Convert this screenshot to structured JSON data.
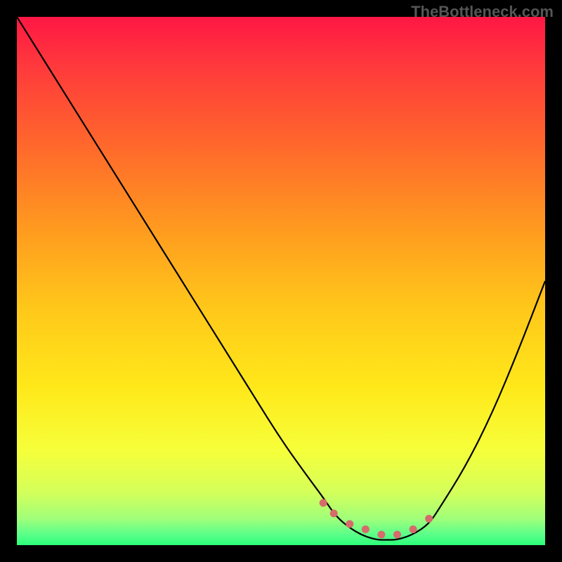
{
  "watermark": "TheBottleneck.com",
  "chart_data": {
    "type": "line",
    "title": "",
    "xlabel": "",
    "ylabel": "",
    "xlim": [
      0,
      100
    ],
    "ylim": [
      0,
      100
    ],
    "series": [
      {
        "name": "bottleneck-curve",
        "x": [
          0,
          5,
          10,
          15,
          20,
          25,
          30,
          35,
          40,
          45,
          50,
          55,
          58,
          60,
          62,
          65,
          68,
          70,
          72,
          75,
          78,
          80,
          85,
          90,
          95,
          100
        ],
        "y": [
          100,
          92,
          84,
          76,
          68,
          60,
          52,
          44,
          36,
          28,
          20,
          13,
          9,
          6,
          4,
          2,
          1,
          1,
          1,
          2,
          4,
          7,
          15,
          25,
          37,
          50
        ]
      }
    ],
    "markers": {
      "name": "optimal-range-dots",
      "x": [
        58,
        60,
        63,
        66,
        69,
        72,
        75,
        78
      ],
      "y": [
        8,
        6,
        4,
        3,
        2,
        2,
        3,
        5
      ],
      "color": "#d66b6b"
    },
    "annotations": [],
    "gradient_stops": [
      {
        "offset": 0.0,
        "color": "#ff1744"
      },
      {
        "offset": 0.1,
        "color": "#ff3b3b"
      },
      {
        "offset": 0.25,
        "color": "#ff6a2b"
      },
      {
        "offset": 0.4,
        "color": "#ff9a1f"
      },
      {
        "offset": 0.55,
        "color": "#ffc71a"
      },
      {
        "offset": 0.7,
        "color": "#ffe81a"
      },
      {
        "offset": 0.82,
        "color": "#f6ff3a"
      },
      {
        "offset": 0.9,
        "color": "#d4ff5a"
      },
      {
        "offset": 0.95,
        "color": "#a0ff7a"
      },
      {
        "offset": 0.98,
        "color": "#5aff8a"
      },
      {
        "offset": 1.0,
        "color": "#2aff7a"
      }
    ]
  }
}
